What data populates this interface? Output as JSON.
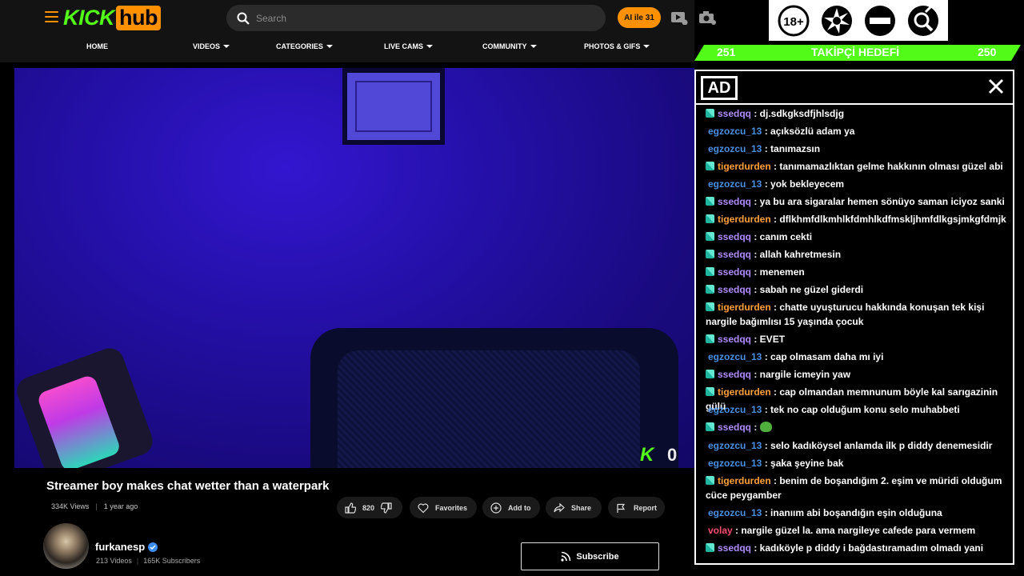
{
  "header": {
    "logo_kick": "KICK",
    "logo_hub": "hub",
    "search_placeholder": "Search",
    "ai_button": "AI ile 31",
    "nav": [
      {
        "label": "HOME"
      },
      {
        "label": "VIDEOS"
      },
      {
        "label": "CATEGORIES"
      },
      {
        "label": "LIVE CAMS"
      },
      {
        "label": "COMMUNITY"
      },
      {
        "label": "PHOTOS & GIFS"
      }
    ]
  },
  "badges": [
    "18+ badge",
    "censor badge",
    "no-entry badge",
    "search-gender badge"
  ],
  "goal": {
    "current": "251",
    "label": "TAKİPÇİ HEDEFİ",
    "target": "250"
  },
  "video": {
    "overlay_count": "0",
    "title": "Streamer boy makes chat wetter than a waterpark",
    "views": "334K Views",
    "age": "1 year ago",
    "likes": "820",
    "actions": {
      "favorites": "Favorites",
      "add_to": "Add to",
      "share": "Share",
      "report": "Report"
    }
  },
  "channel": {
    "name": "furkanesp",
    "videos": "213 Videos",
    "subscribers": "165K Subscribers",
    "subscribe_label": "Subscribe"
  },
  "chat": {
    "ad_label": "AD",
    "messages": [
      {
        "user": "ssedqq",
        "badge": true,
        "text": ": dj.sdkgksdfjhlsdjg"
      },
      {
        "user": "egzozcu_13",
        "badge": false,
        "text": ": açıksözlü adam ya"
      },
      {
        "user": "egzozcu_13",
        "badge": false,
        "text": ": tanımazsın"
      },
      {
        "user": "tigerdurden",
        "badge": true,
        "text": ": tanımamazlıktan gelme hakkının olması güzel abi"
      },
      {
        "user": "egzozcu_13",
        "badge": false,
        "text": ": yok bekleyecem"
      },
      {
        "user": "ssedqq",
        "badge": true,
        "text": ": ya bu ara sigaralar hemen sönüyo saman iciyoz sanki"
      },
      {
        "user": "tigerdurden",
        "badge": true,
        "text": ": dflkhmfdlkmhlkfdmhlkdfmskljhmfdlkgsjmkgfdmjk"
      },
      {
        "user": "ssedqq",
        "badge": true,
        "text": ": canım cekti"
      },
      {
        "user": "ssedqq",
        "badge": true,
        "text": ": allah kahretmesin"
      },
      {
        "user": "ssedqq",
        "badge": true,
        "text": ": menemen"
      },
      {
        "user": "ssedqq",
        "badge": true,
        "text": ": sabah ne güzel giderdi"
      },
      {
        "user": "tigerdurden",
        "badge": true,
        "text": ": chatte uyuşturucu hakkında konuşan tek kişi nargile bağımlısı 15 yaşında çocuk"
      },
      {
        "user": "ssedqq",
        "badge": true,
        "text": ": EVET"
      },
      {
        "user": "egzozcu_13",
        "badge": false,
        "text": ": cap olmasam daha mı iyi"
      },
      {
        "user": "ssedqq",
        "badge": true,
        "text": ": nargile icmeyin yaw"
      },
      {
        "user": "tigerdurden",
        "badge": true,
        "text": ": cap olmandan memnunum böyle kal sarıgazinin gülü"
      },
      {
        "user": "egzozcu_13",
        "badge": false,
        "text": ": tek no cap olduğum konu selo muhabbeti"
      },
      {
        "user": "ssedqq",
        "badge": true,
        "text": ":",
        "emote": "frog-emote"
      },
      {
        "user": "egzozcu_13",
        "badge": false,
        "text": ": selo kadıköysel anlamda ilk p diddy denemesidir"
      },
      {
        "user": "egzozcu_13",
        "badge": false,
        "text": ": şaka şeyine bak"
      },
      {
        "user": "tigerdurden",
        "badge": true,
        "text": ": benim de boşandığım 2. eşim ve müridi olduğum cüce peygamber"
      },
      {
        "user": "egzozcu_13",
        "badge": false,
        "text": ": inanıım abi boşandığın eşin olduğuna"
      },
      {
        "user": "volay",
        "badge": false,
        "text": ": nargile güzel la. ama nargileye cafede para vermem"
      },
      {
        "user": "ssedqq",
        "badge": true,
        "text": ": kadıköyle p diddy i bağdastıramadım olmadı yani"
      }
    ]
  },
  "colors": {
    "brand_green": "#53fc18",
    "brand_orange": "#ff9000",
    "user_purple": "#b18cff",
    "user_blue": "#4a90e2",
    "user_orange": "#ffa03a",
    "user_red": "#ff4d6d"
  }
}
